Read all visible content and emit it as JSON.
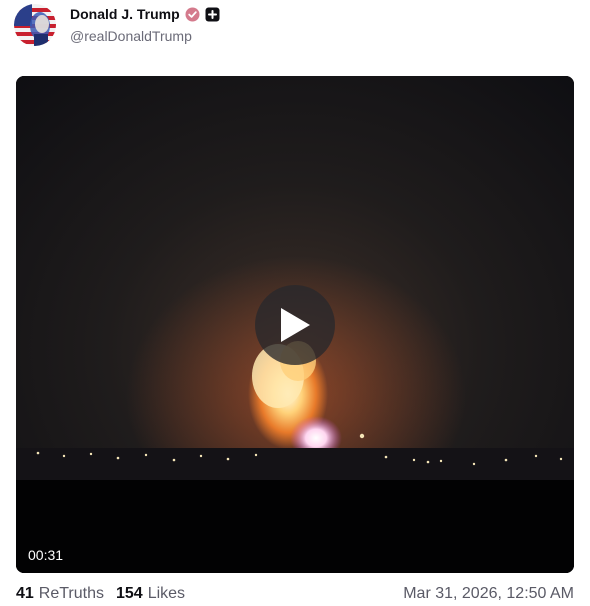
{
  "author": {
    "display_name": "Donald J. Trump",
    "handle": "@realDonaldTrump",
    "avatar_icon": "profile-avatar-flag",
    "verified_icon": "verified-badge-icon",
    "extra_icon": "plus-square-icon"
  },
  "media": {
    "type": "video",
    "duration": "00:31",
    "play_icon": "play-icon"
  },
  "stats": {
    "retruths_count": "41",
    "retruths_label": "ReTruths",
    "likes_count": "154",
    "likes_label": "Likes"
  },
  "timestamp": "Mar 31, 2026, 12:50 AM",
  "colors": {
    "verified_badge": "#d47a8c",
    "text_primary": "#0f0f14",
    "text_secondary": "#5a5a66"
  }
}
